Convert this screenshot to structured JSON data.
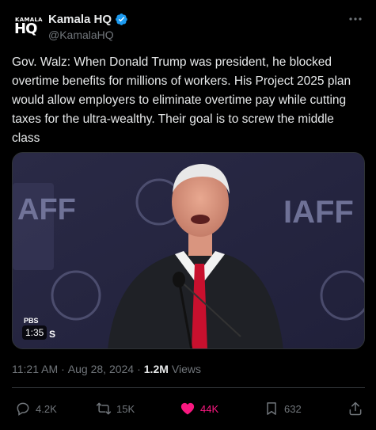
{
  "author": {
    "avatar_text_top": "KAMALA",
    "avatar_text_bottom": "HQ",
    "name": "Kamala HQ",
    "handle": "@KamalaHQ",
    "verified_icon": "verified-badge-icon",
    "more_icon": "more-icon"
  },
  "post": {
    "text": "Gov. Walz: When Donald Trump was president, he blocked overtime benefits for millions of workers. His Project 2025 plan would allow employers to eliminate overtime pay while cutting taxes for the ultra-wealthy. Their goal is to screw the middle class"
  },
  "media": {
    "backdrop_text_left": "AFF",
    "backdrop_text_right": "IAFF",
    "duration": "1:35",
    "watermark_top": "PBS",
    "watermark_s": "S"
  },
  "meta": {
    "time": "11:21 AM",
    "separator1": "·",
    "date": "Aug 28, 2024",
    "separator2": "·",
    "views_count": "1.2M",
    "views_label": "Views"
  },
  "actions": {
    "replies": "4.2K",
    "reposts": "15K",
    "likes": "44K",
    "bookmarks": "632"
  },
  "colors": {
    "background": "#000000",
    "text_primary": "#e7e9ea",
    "text_secondary": "#71767b",
    "verified_blue": "#1d9bf0",
    "like_pink": "#f91880"
  }
}
